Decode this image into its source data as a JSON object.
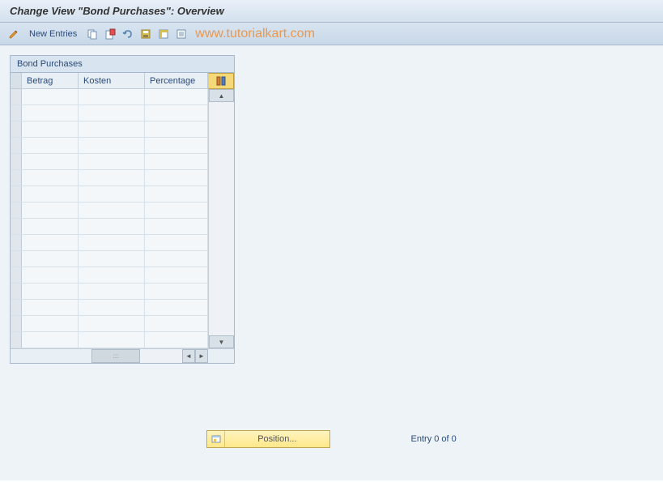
{
  "title": "Change View \"Bond Purchases\": Overview",
  "toolbar": {
    "new_entries_label": "New Entries"
  },
  "watermark": "www.tutorialkart.com",
  "panel": {
    "title": "Bond Purchases",
    "columns": {
      "c1": "Betrag",
      "c2": "Kosten",
      "c3": "Percentage"
    }
  },
  "footer": {
    "position_label": "Position...",
    "entry_text": "Entry 0 of 0"
  }
}
